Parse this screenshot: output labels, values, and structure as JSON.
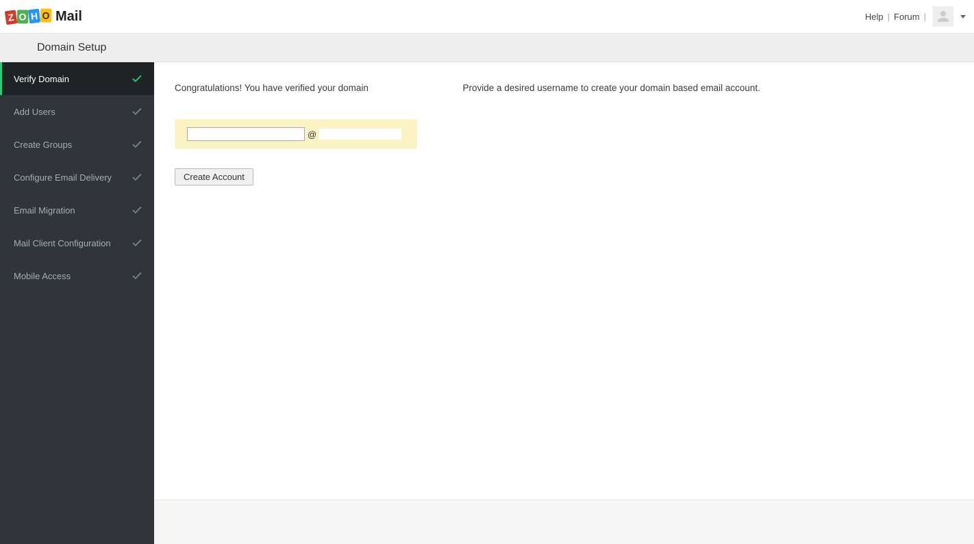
{
  "header": {
    "logo_letters": [
      "Z",
      "O",
      "H",
      "O"
    ],
    "logo_suffix": "Mail",
    "help_label": "Help",
    "forum_label": "Forum"
  },
  "title_bar": {
    "title": "Domain Setup"
  },
  "sidebar": {
    "items": [
      {
        "label": "Verify Domain",
        "active": true,
        "status": "done-green"
      },
      {
        "label": "Add Users",
        "active": false,
        "status": "done-grey"
      },
      {
        "label": "Create Groups",
        "active": false,
        "status": "done-grey"
      },
      {
        "label": "Configure Email Delivery",
        "active": false,
        "status": "done-grey"
      },
      {
        "label": "Email Migration",
        "active": false,
        "status": "done-grey"
      },
      {
        "label": "Mail Client Configuration",
        "active": false,
        "status": "done-grey"
      },
      {
        "label": "Mobile Access",
        "active": false,
        "status": "done-grey"
      }
    ]
  },
  "main": {
    "intro_prefix": "Congratulations! You have verified your domain ",
    "intro_suffix": " Provide a desired username to create your domain based email account.",
    "username_value": "",
    "at_symbol": "@",
    "create_button_label": "Create Account"
  }
}
